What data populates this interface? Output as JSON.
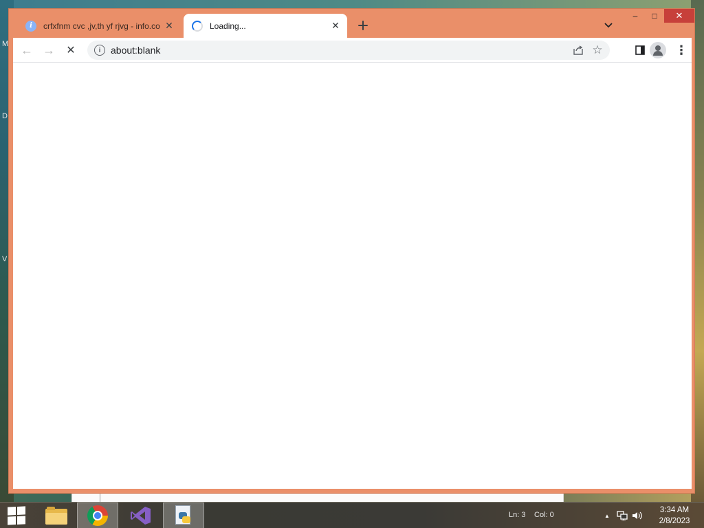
{
  "desktop": {
    "left_labels": [
      "M",
      "D",
      "V"
    ]
  },
  "browser": {
    "tabs": [
      {
        "title": "crfxfnm cvc ,jv,th yf rjvg - info.co",
        "active": false,
        "icon": "info-icon"
      },
      {
        "title": "Loading...",
        "active": true,
        "icon": "loading-spinner-icon"
      }
    ],
    "new_tab_icon": "plus-icon",
    "tab_search_icon": "chevron-down-icon",
    "window_controls": {
      "minimize": "–",
      "maximize": "□",
      "close": "✕"
    },
    "toolbar": {
      "back_icon": "←",
      "forward_icon": "→",
      "stop_icon": "✕",
      "url": "about:blank",
      "site_info_icon": "i",
      "share_icon": "share-icon",
      "bookmark_icon": "☆",
      "side_panel_icon": "side-panel-icon",
      "menu_icon": "⋮"
    }
  },
  "taskbar": {
    "apps": [
      {
        "name": "File Explorer",
        "icon": "folder-icon",
        "active": false
      },
      {
        "name": "Google Chrome",
        "icon": "chrome-icon",
        "active": true
      },
      {
        "name": "Visual Studio",
        "icon": "visual-studio-icon",
        "active": false
      },
      {
        "name": "Python",
        "icon": "python-file-icon",
        "active": true
      }
    ],
    "editor_status": {
      "line": "Ln: 3",
      "col": "Col: 0"
    },
    "tray": {
      "show_hidden_icon": "▲",
      "network_icon": "network-icon",
      "volume_icon": "volume-icon"
    },
    "clock": {
      "time": "3:34 AM",
      "date": "2/8/2023"
    }
  }
}
